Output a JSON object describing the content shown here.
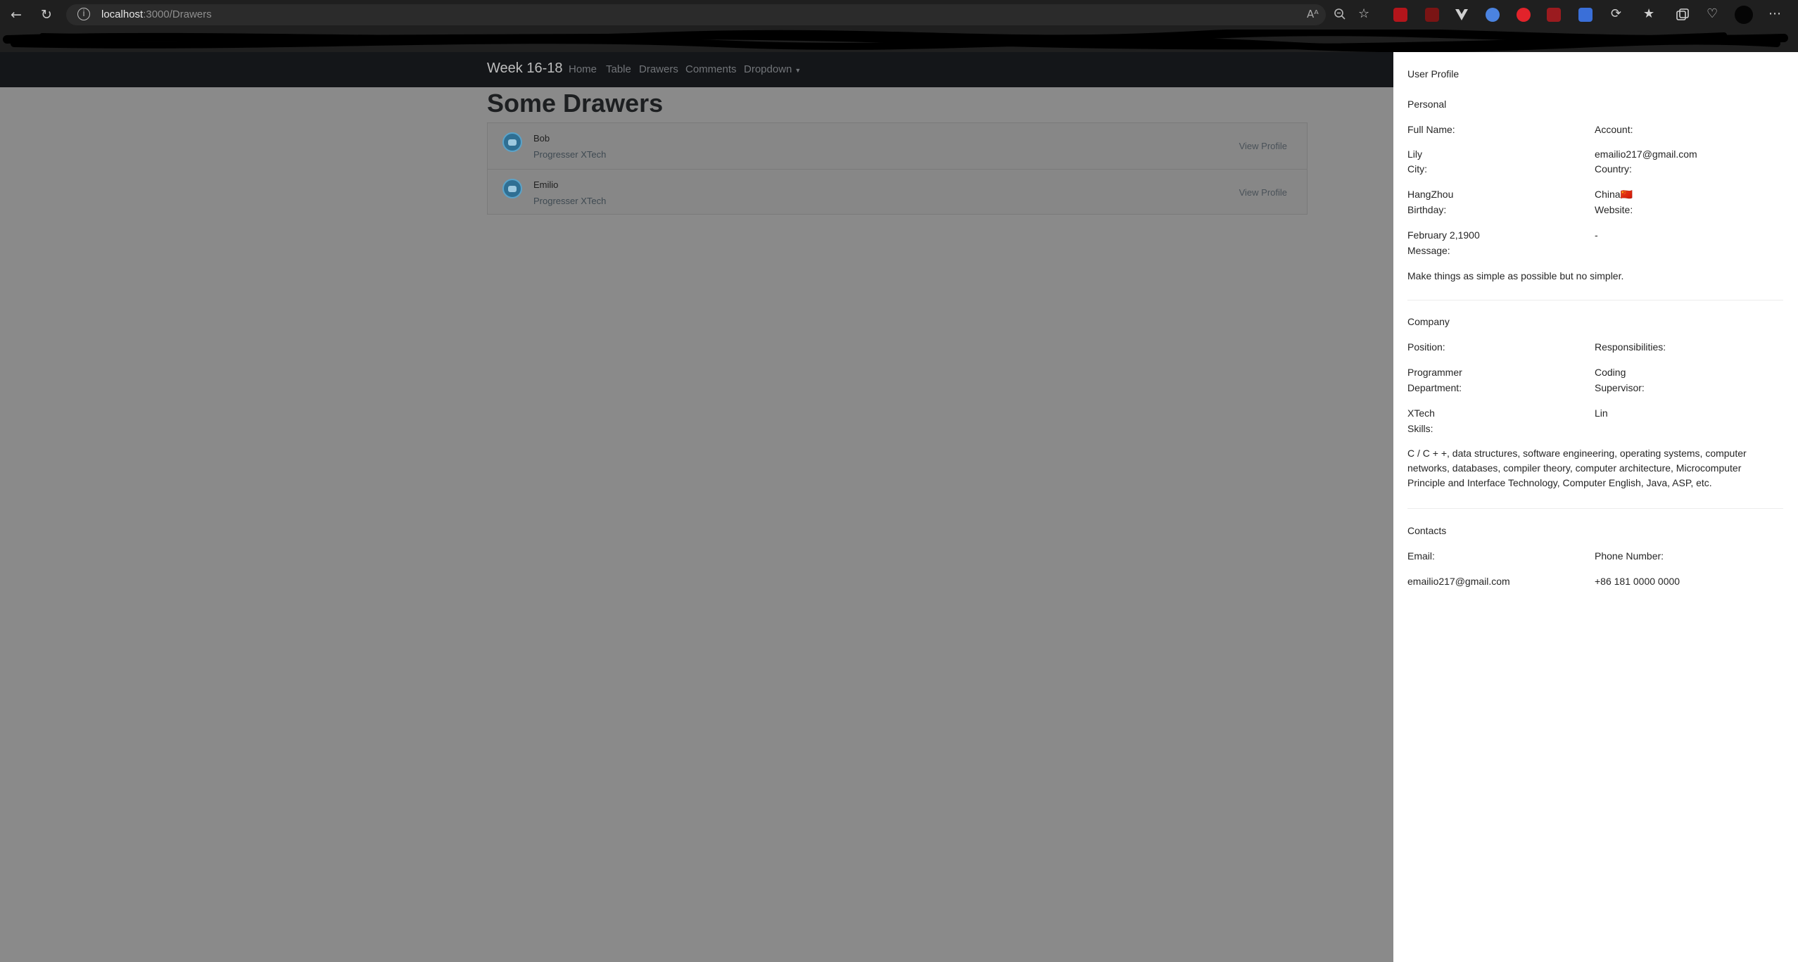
{
  "browser": {
    "url_host": "localhost",
    "url_path": ":3000/Drawers",
    "read_aloud_label": "Aᴬ"
  },
  "navbar": {
    "brand": "Week 16-18",
    "links": [
      "Home",
      "Table",
      "Drawers",
      "Comments",
      "Dropdown"
    ]
  },
  "page": {
    "title": "Some Drawers",
    "items": [
      {
        "name": "Bob",
        "subtitle": "Progresser XTech",
        "action": "View Profile"
      },
      {
        "name": "Emilio",
        "subtitle": "Progresser XTech",
        "action": "View Profile"
      }
    ]
  },
  "drawer": {
    "title": "User Profile",
    "personal": {
      "heading": "Personal",
      "full_name_label": "Full Name:",
      "full_name": "Lily",
      "account_label": "Account:",
      "account": "emailio217@gmail.com",
      "city_label": "City:",
      "city": "HangZhou",
      "country_label": "Country:",
      "country": "China🇨🇳",
      "birthday_label": "Birthday:",
      "birthday": "February 2,1900",
      "website_label": "Website:",
      "website": "-",
      "message_label": "Message:",
      "message": "Make things as simple as possible but no simpler."
    },
    "company": {
      "heading": "Company",
      "position_label": "Position:",
      "position": "Programmer",
      "responsibilities_label": "Responsibilities:",
      "responsibilities": "Coding",
      "department_label": "Department:",
      "department": "XTech",
      "supervisor_label": "Supervisor:",
      "supervisor": "Lin",
      "skills_label": "Skills:",
      "skills": "C / C + +, data structures, software engineering, operating systems, computer networks, databases, compiler theory, computer architecture, Microcomputer Principle and Interface Technology, Computer English, Java, ASP, etc."
    },
    "contacts": {
      "heading": "Contacts",
      "email_label": "Email:",
      "email": "emailio217@gmail.com",
      "phone_label": "Phone Number:",
      "phone": "+86 181 0000 0000"
    }
  }
}
